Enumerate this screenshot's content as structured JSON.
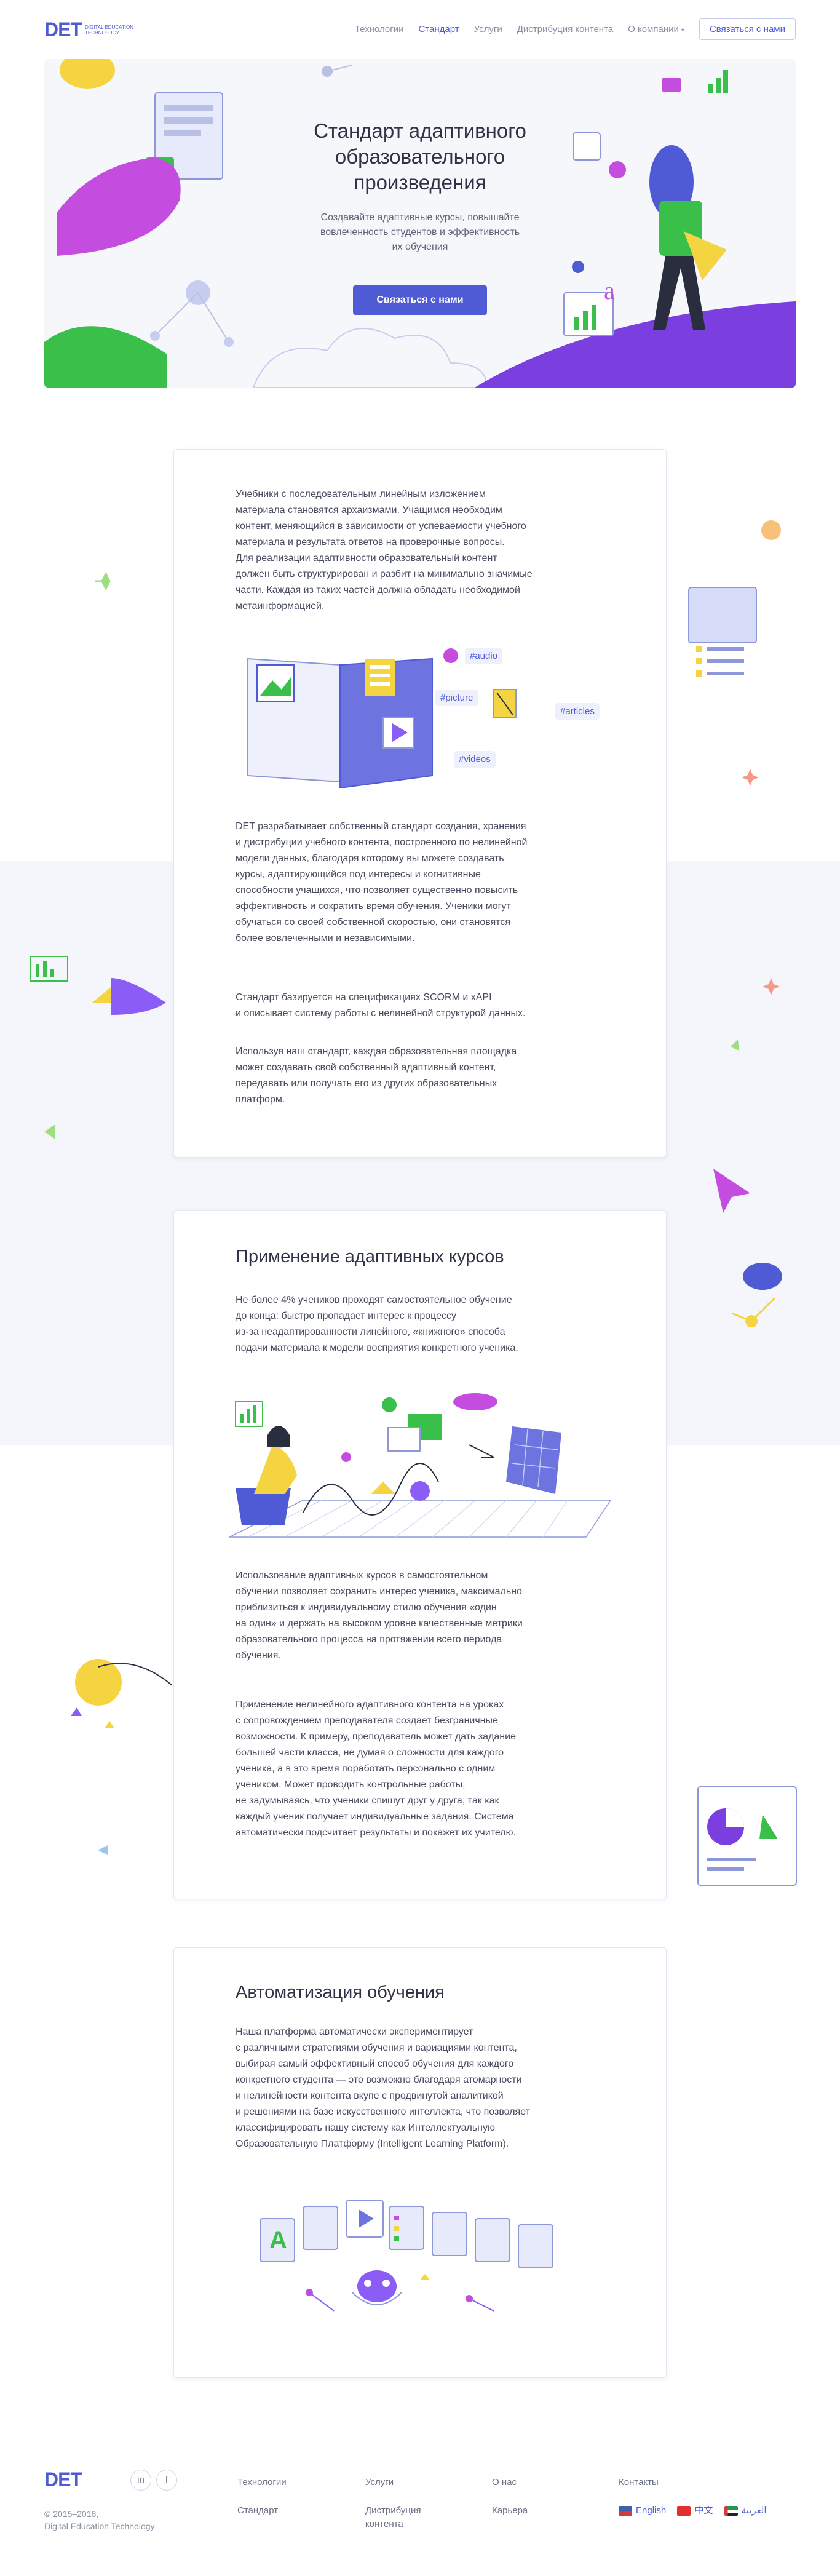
{
  "header": {
    "logo": "DET",
    "logo_sub": "Digital Education Technology",
    "nav": [
      "Технологии",
      "Стандарт",
      "Услуги",
      "Дистрибуция контента",
      "О компании"
    ],
    "contact_button": "Связаться с нами"
  },
  "hero": {
    "title_lines": [
      "Стандарт адаптивного",
      "образовательного",
      "произведения"
    ],
    "subtitle_lines": [
      "Создавайте адаптивные курсы, повышайте",
      "вовлеченность студентов и эффективность",
      "их обучения"
    ],
    "button": "Связаться с нами"
  },
  "intro": {
    "p1": [
      "Учебники с последовательным линейным изложением",
      "материала становятся архаизмами. Учащимся необходим",
      "контент, меняющийся в зависимости от успеваемости учебного",
      "материала и результата ответов на проверочные вопросы.",
      "Для реализации адаптивности образовательный контент",
      "должен быть структурирован и разбит на минимально значимые",
      "части. Каждая из таких частей должна обладать необходимой",
      "метаинформацией."
    ],
    "tags": [
      "#audio",
      "#picture",
      "#articles",
      "#videos"
    ],
    "p2": [
      "DET разрабатывает собственный стандарт создания, хранения",
      "и дистрибуции учебного контента, построенного по нелинейной",
      "модели данных, благодаря которому вы можете создавать",
      "курсы, адаптирующийся под интересы и когнитивные",
      "способности учащихся, что позволяет существенно повысить",
      "эффективность и сократить время обучения. Ученики могут",
      "обучаться со своей собственной скоростью, они становятся",
      "более вовлеченными и независимыми."
    ],
    "p3": [
      "Стандарт базируется на спецификациях SCORM и xAPI",
      "и описывает систему работы с нелинейной структурой данных."
    ],
    "p4": [
      "Используя наш стандарт, каждая образовательная площадка",
      "может создавать свой собственный адаптивный контент,",
      "передавать или получать его из других образовательных",
      "платформ."
    ]
  },
  "adaptive": {
    "title": "Применение адаптивных курсов",
    "p1": [
      "Не более 4% учеников проходят самостоятельное обучение",
      "до конца: быстро пропадает интерес к процессу",
      "из-за неадаптированности линейного, «книжного» способа",
      "подачи материала к модели восприятия конкретного ученика."
    ],
    "p2": [
      "Использование адаптивных курсов в самостоятельном",
      "обучении позволяет сохранить интерес ученика, максимально",
      "приблизиться к индивидуальному стилю обучения «один",
      "на один» и держать на высоком уровне качественные метрики",
      "образовательного процесса на протяжении всего периода",
      "обучения."
    ],
    "p3": [
      "Применение нелинейного адаптивного контента на уроках",
      "с сопровождением преподавателя создает безграничные",
      "возможности. К примеру, преподаватель может дать задание",
      "большей части класса, не думая о сложности для каждого",
      "ученика, а в это время поработать персонально с одним",
      "учеником. Может проводить контрольные работы,",
      "не задумываясь, что ученики спишут друг у друга, так как",
      "каждый ученик получает индивидуальные задания. Система",
      "автоматически подсчитает результаты и покажет их учителю."
    ]
  },
  "automation": {
    "title": "Автоматизация обучения",
    "p1": [
      "Наша платформа автоматически экспериментирует",
      "с различными стратегиями обучения и вариациями контента,",
      "выбирая самый эффективный способ обучения для каждого",
      "конкретного студента — это возможно благодаря атомарности",
      "и нелинейности контента вкупе с продвинутой аналитикой",
      "и решениями на базе искусственного интеллекта, что позволяет",
      "классифицировать нашу систему как Интеллектуальную",
      "Образовательную Платформу (Intelligent Learning Platform)."
    ]
  },
  "footer": {
    "logo": "DET",
    "copyright": "© 2015–2018,",
    "company": "Digital Education Technology",
    "social": [
      "in",
      "f"
    ],
    "col1": [
      "Технологии",
      "Стандарт"
    ],
    "col2": [
      "Услуги",
      "Дистрибуция",
      "контента"
    ],
    "col3": [
      "О нас",
      "Карьера"
    ],
    "col4_title": "Контакты",
    "languages": [
      "English",
      "中文",
      "العربية"
    ]
  },
  "colors": {
    "accent": "#4f5bd5",
    "purple": "#8b5cf6",
    "yellow": "#f5d442",
    "green": "#3ac04a",
    "background_band": "#f4f6fb"
  }
}
